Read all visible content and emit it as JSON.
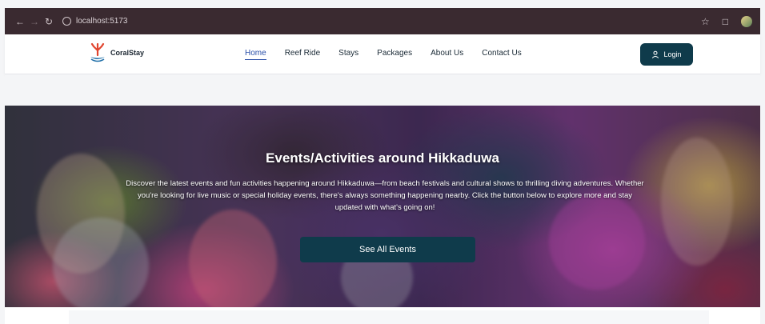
{
  "browser": {
    "back_icon": "arrow-left-icon",
    "forward_icon": "arrow-right-icon",
    "reload_icon": "reload-icon",
    "url": "localhost:5173",
    "star_icon": "star-icon",
    "extensions_icon": "extensions-icon"
  },
  "navbar": {
    "brand": "CoralStay",
    "links": [
      "Home",
      "Reef Ride",
      "Stays",
      "Packages",
      "About Us",
      "Contact Us"
    ],
    "active_link": "Home",
    "login_label": "Login"
  },
  "hero": {
    "title": "Events/Activities around Hikkaduwa",
    "description": "Discover the latest events and fun activities happening around Hikkaduwa—from beach festivals and cultural shows to thrilling diving adventures. Whether you're looking for live music or special holiday events, there's always something happening nearby. Click the button below to explore more and stay updated with what's going on!",
    "button_label": "See All Events"
  },
  "colors": {
    "primary": "#0f3b4b",
    "active_link": "#2a4fa8",
    "chrome": "#3a2a30"
  }
}
